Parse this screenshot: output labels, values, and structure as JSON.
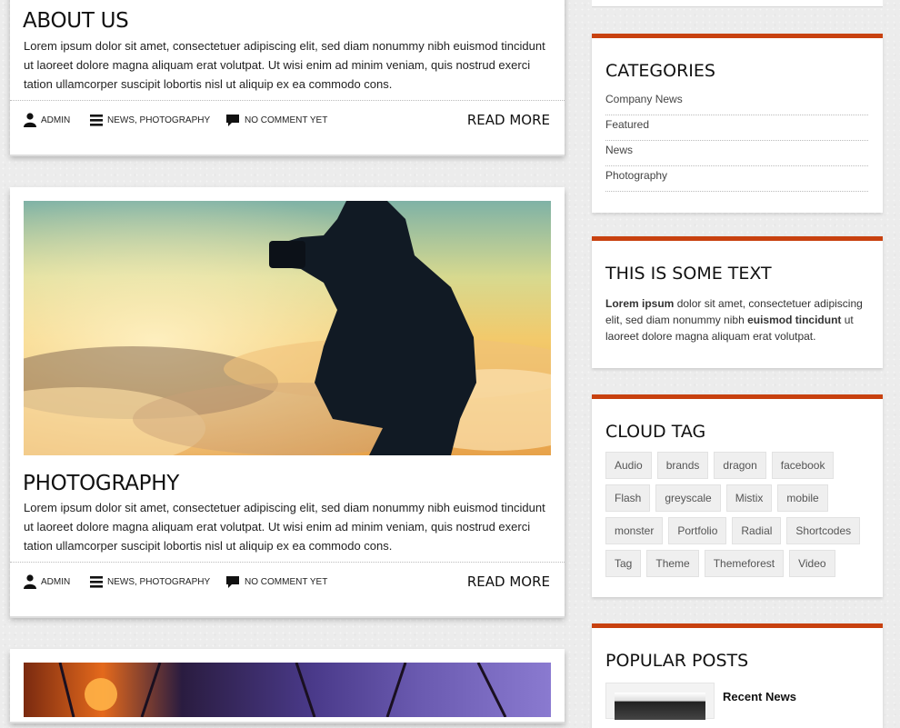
{
  "posts": [
    {
      "title": "ABOUT US",
      "excerpt": "Lorem ipsum dolor sit amet, consectetuer adipiscing elit, sed diam nonummy nibh euismod tincidunt ut laoreet dolore magna aliquam erat volutpat. Ut wisi enim ad minim veniam, quis nostrud exerci tation ullamcorper suscipit lobortis nisl ut aliquip ex ea commodo cons.",
      "author": "ADMIN",
      "categories": "NEWS, PHOTOGRAPHY",
      "comments": "NO COMMENT YET",
      "read_more": "READ MORE"
    },
    {
      "title": "PHOTOGRAPHY",
      "excerpt": "Lorem ipsum dolor sit amet, consectetuer adipiscing elit, sed diam nonummy nibh euismod tincidunt ut laoreet dolore magna aliquam erat volutpat. Ut wisi enim ad minim veniam, quis nostrud exerci tation ullamcorper suscipit lobortis nisl ut aliquip ex ea commodo cons.",
      "author": "ADMIN",
      "categories": "NEWS, PHOTOGRAPHY",
      "comments": "NO COMMENT YET",
      "read_more": "READ MORE"
    }
  ],
  "sidebar": {
    "categories": {
      "title": "CATEGORIES",
      "items": [
        "Company News",
        "Featured",
        "News",
        "Photography"
      ]
    },
    "text_widget": {
      "title": "THIS IS SOME TEXT",
      "bold1": "Lorem ipsum",
      "text1": " dolor sit amet, consectetuer adipiscing elit, sed diam nonummy nibh ",
      "bold2": "euismod tincidunt",
      "text2": " ut laoreet dolore magna aliquam erat volutpat."
    },
    "cloud_tag": {
      "title": "CLOUD TAG",
      "tags": [
        "Audio",
        "brands",
        "dragon",
        "facebook",
        "Flash",
        "greyscale",
        "Mistix",
        "mobile",
        "monster",
        "Portfolio",
        "Radial",
        "Shortcodes",
        "Tag",
        "Theme",
        "Themeforest",
        "Video"
      ]
    },
    "popular_posts": {
      "title": "POPULAR POSTS",
      "first_post": "Recent News"
    }
  },
  "colors": {
    "accent": "#c8410f",
    "background": "#ececec"
  }
}
